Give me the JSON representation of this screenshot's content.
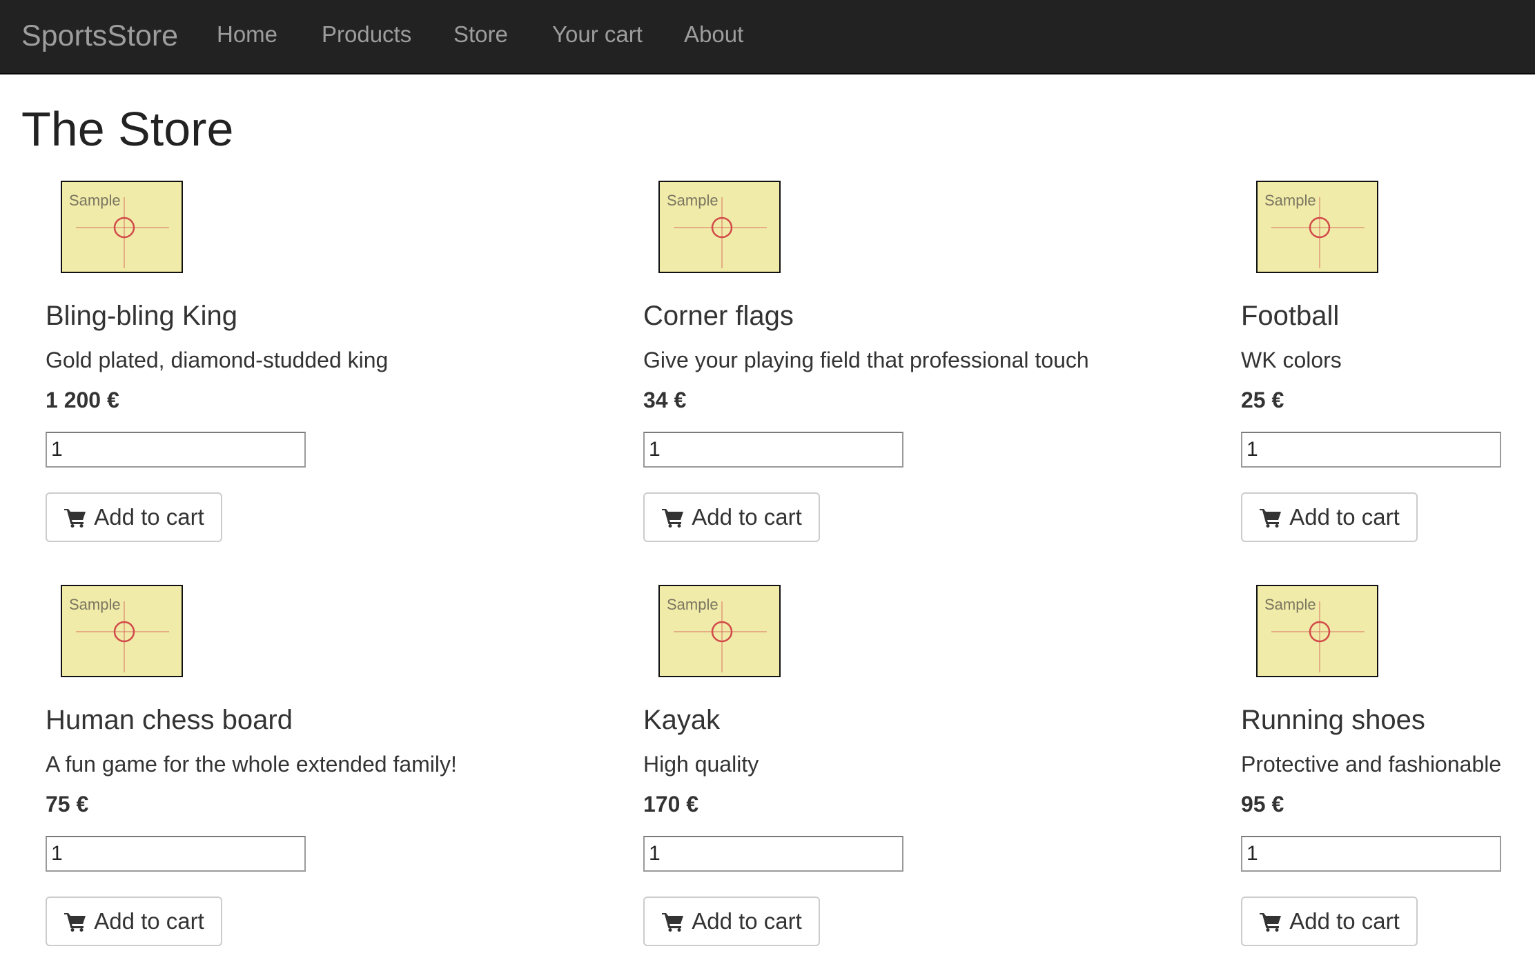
{
  "navbar": {
    "brand": "SportsStore",
    "links": [
      {
        "label": "Home"
      },
      {
        "label": "Products"
      },
      {
        "label": "Store"
      },
      {
        "label": "Your cart"
      },
      {
        "label": "About"
      }
    ]
  },
  "page": {
    "title": "The Store"
  },
  "thumbnail_label": "Sample",
  "colors": {
    "navbar_bg": "#222222",
    "navbar_text": "#9d9d9d",
    "thumbnail_bg": "#f0eba8",
    "crosshair": "#d24a4a"
  },
  "products": [
    {
      "name": "Bling-bling King",
      "description": "Gold plated, diamond-studded king",
      "price": "1 200 €",
      "quantity": "1",
      "button_label": "Add to cart",
      "icon": "shopping-cart-icon"
    },
    {
      "name": "Corner flags",
      "description": "Give your playing field that professional touch",
      "price": "34 €",
      "quantity": "1",
      "button_label": "Add to cart",
      "icon": "shopping-cart-icon"
    },
    {
      "name": "Football",
      "description": "WK colors",
      "price": "25 €",
      "quantity": "1",
      "button_label": "Add to cart",
      "icon": "shopping-cart-icon"
    },
    {
      "name": "Human chess board",
      "description": "A fun game for the whole extended family!",
      "price": "75 €",
      "quantity": "1",
      "button_label": "Add to cart",
      "icon": "shopping-cart-icon"
    },
    {
      "name": "Kayak",
      "description": "High quality",
      "price": "170 €",
      "quantity": "1",
      "button_label": "Add to cart",
      "icon": "shopping-cart-icon"
    },
    {
      "name": "Running shoes",
      "description": "Protective and fashionable",
      "price": "95 €",
      "quantity": "1",
      "button_label": "Add to cart",
      "icon": "shopping-cart-icon"
    }
  ]
}
